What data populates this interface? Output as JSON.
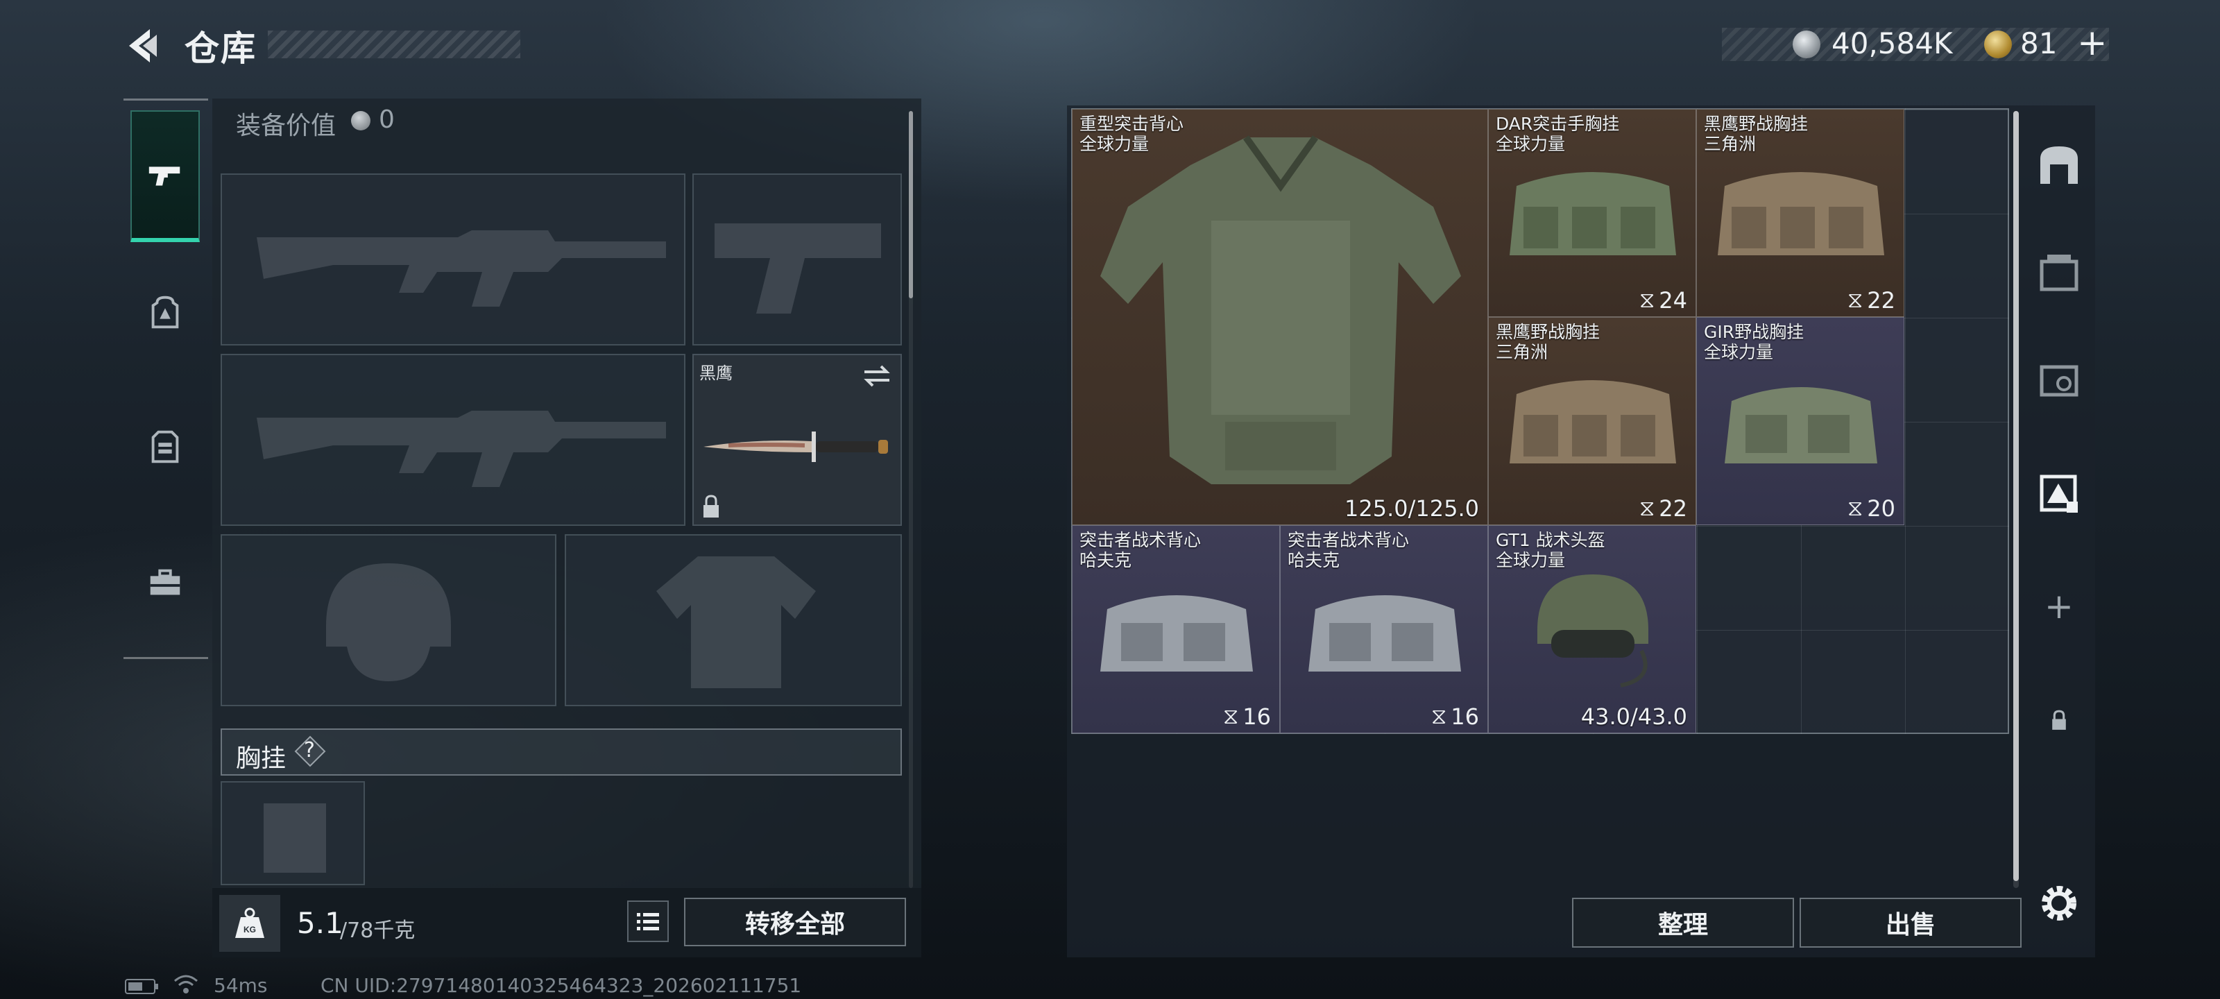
{
  "header": {
    "title": "仓库",
    "coins": "40,584K",
    "tokens": "81",
    "tokens_plus": "+"
  },
  "left_tabs": [
    {
      "name": "weapons",
      "icon": "pistol-icon",
      "active": true
    },
    {
      "name": "backpack",
      "icon": "backpack-icon",
      "active": false
    },
    {
      "name": "vest",
      "icon": "vest-icon",
      "active": false
    },
    {
      "name": "toolbox",
      "icon": "toolbox-icon",
      "active": false
    }
  ],
  "equipment": {
    "value_label": "装备价值",
    "value": "0",
    "melee_name": "黑鹰",
    "chestrig_label": "胸挂",
    "chestrig_help": "?",
    "weight_value": "5.1",
    "weight_cap": "/78千克",
    "transfer_all": "转移全部"
  },
  "storage": {
    "items": [
      {
        "name": "重型突击背心",
        "sub": "全球力量",
        "value": "125.0/125.0"
      },
      {
        "name": "DAR突击手胸挂",
        "sub": "全球力量",
        "capacity": "24"
      },
      {
        "name": "黑鹰野战胸挂",
        "sub": "三角洲",
        "capacity": "22"
      },
      {
        "name": "黑鹰野战胸挂",
        "sub": "三角洲",
        "capacity": "22"
      },
      {
        "name": "GIR野战胸挂",
        "sub": "全球力量",
        "capacity": "20"
      },
      {
        "name": "突击者战术背心",
        "sub": "哈夫克",
        "capacity": "16"
      },
      {
        "name": "突击者战术背心",
        "sub": "哈夫克",
        "capacity": "16"
      },
      {
        "name": "GT1 战术头盔",
        "sub": "全球力量",
        "value": "43.0/43.0"
      }
    ],
    "organize": "整理",
    "sell": "出售",
    "add_tab": "+"
  },
  "status": {
    "ping": "54ms",
    "uid": "CN UID:27971480140325464323_202602111751"
  },
  "colors": {
    "accent": "#34d3ad",
    "brown_item": "#4a3a2e",
    "purple_item": "#3e3d56"
  }
}
